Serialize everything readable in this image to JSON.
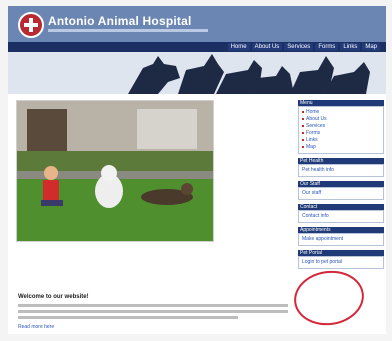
{
  "header": {
    "title": "Antonio Animal Hospital",
    "brand_color": "#6b86b3",
    "logo_icon": "paw-cross-icon"
  },
  "nav": {
    "items": [
      "Home",
      "About Us",
      "Services",
      "Forms",
      "Links",
      "Map"
    ]
  },
  "main": {
    "welcome_heading": "Welcome to our website!",
    "read_more": "Read more here"
  },
  "sidebar": {
    "sections": [
      {
        "title": "Menu",
        "links": [
          "Home",
          "About Us",
          "Services",
          "Forms",
          "Links",
          "Map"
        ]
      },
      {
        "title": "Pet Health",
        "links": [
          "Pet health info"
        ]
      },
      {
        "title": "Our Staff",
        "links": [
          "Our staff"
        ]
      },
      {
        "title": "Contact",
        "links": [
          "Contact info"
        ]
      },
      {
        "title": "Appointments",
        "links": [
          "Make appointment"
        ]
      },
      {
        "title": "Pet Portal",
        "links": [
          "Login to pet portal"
        ]
      }
    ]
  },
  "annotation": {
    "circle_color": "#d3283a"
  }
}
